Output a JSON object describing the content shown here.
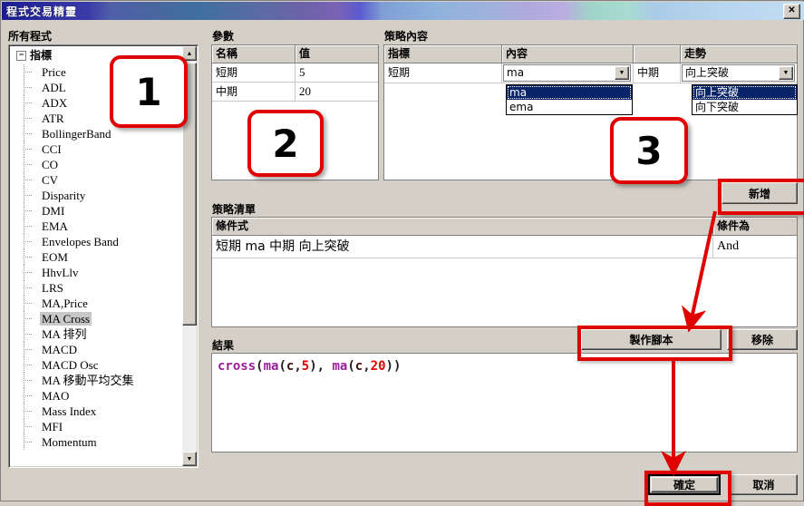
{
  "window": {
    "title": "程式交易精靈",
    "close_label": "✕"
  },
  "tree": {
    "group_label": "所有程式",
    "root": "指標",
    "expander": "−",
    "selected": "MA Cross",
    "items": [
      "Price",
      "ADL",
      "ADX",
      "ATR",
      "BollingerBand",
      "CCI",
      "CO",
      "CV",
      "Disparity",
      "DMI",
      "EMA",
      "Envelopes Band",
      "EOM",
      "HhvLlv",
      "LRS",
      "MA,Price",
      "MA Cross",
      "MA 排列",
      "MACD",
      "MACD Osc",
      "MA 移動平均交集",
      "MAO",
      "Mass Index",
      "MFI",
      "Momentum"
    ],
    "scroll_up": "▲",
    "scroll_down": "▼"
  },
  "params": {
    "group_label": "參數",
    "columns": [
      "名稱",
      "值"
    ],
    "rows": [
      {
        "name": "短期",
        "value": "5"
      },
      {
        "name": "中期",
        "value": "20"
      }
    ]
  },
  "content": {
    "group_label": "策略內容",
    "columns": [
      "指標",
      "內容",
      "",
      "走勢"
    ],
    "row": {
      "indicator": "短期",
      "formula_value": "ma",
      "middle": "中期",
      "trend_value": "向上突破"
    },
    "formula_options": [
      "ma",
      "ema"
    ],
    "trend_options": [
      "向上突破",
      "向下突破"
    ],
    "arrow_glyph": "▼"
  },
  "strategy_list": {
    "group_label": "策略清單",
    "columns": [
      "條件式",
      "條件為"
    ],
    "rows": [
      {
        "expression": "短期 ma 中期 向上突破",
        "condition": "And"
      }
    ]
  },
  "result": {
    "group_label": "結果",
    "code_tokens": [
      {
        "text": "cross",
        "color": "#9b1f9b"
      },
      {
        "text": "(",
        "color": "#202020"
      },
      {
        "text": "ma",
        "color": "#9b1f9b"
      },
      {
        "text": "(",
        "color": "#202020"
      },
      {
        "text": "c",
        "color": "#3a1010"
      },
      {
        "text": ",",
        "color": "#202020"
      },
      {
        "text": "5",
        "color": "#e00000"
      },
      {
        "text": "), ",
        "color": "#202020"
      },
      {
        "text": "ma",
        "color": "#9b1f9b"
      },
      {
        "text": "(",
        "color": "#202020"
      },
      {
        "text": "c",
        "color": "#3a1010"
      },
      {
        "text": ",",
        "color": "#202020"
      },
      {
        "text": "20",
        "color": "#e00000"
      },
      {
        "text": "))",
        "color": "#202020"
      }
    ],
    "code_plain": "cross(ma(c,5), ma(c,20))"
  },
  "buttons": {
    "new": "新增",
    "make_script": "製作腳本",
    "remove": "移除",
    "ok": "確定",
    "cancel": "取消"
  },
  "annotations": {
    "step1": "1",
    "step2": "2",
    "step3": "3",
    "accent_color": "#e00000"
  }
}
